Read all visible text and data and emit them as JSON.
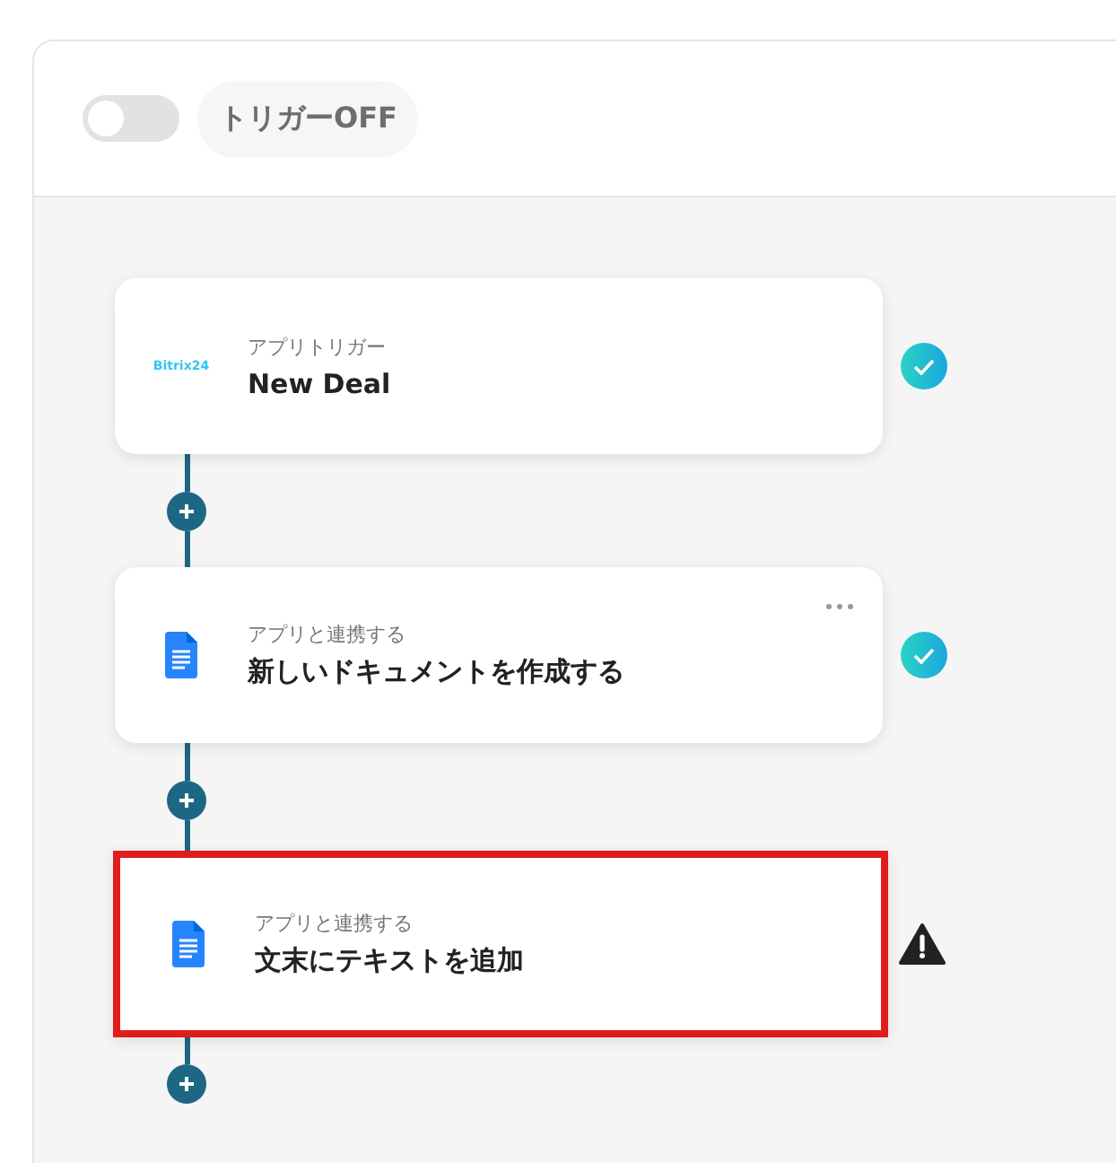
{
  "trigger": {
    "on": false,
    "label": "トリガーOFF"
  },
  "steps": [
    {
      "kind": "bitrix",
      "logo": "Bitrix24",
      "caption": "アプリトリガー",
      "title": "New Deal",
      "warning": false,
      "menu": false,
      "highlighted": false
    },
    {
      "kind": "gdocs",
      "caption": "アプリと連携する",
      "title": "新しいドキュメントを作成する",
      "warning": false,
      "menu": true,
      "highlighted": false
    },
    {
      "kind": "gdocs",
      "caption": "アプリと連携する",
      "title": "文末にテキストを追加",
      "warning": true,
      "menu": false,
      "highlighted": true
    }
  ]
}
